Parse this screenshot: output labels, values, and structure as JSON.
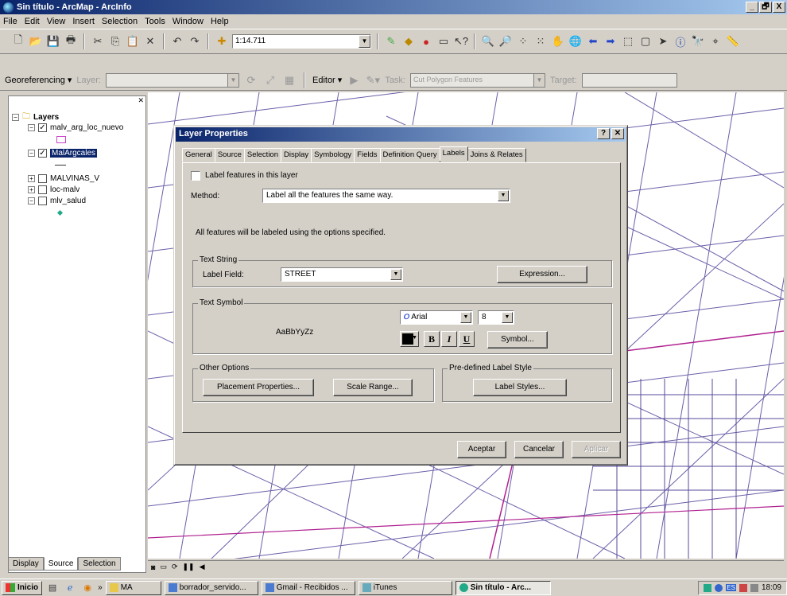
{
  "window": {
    "title": "Sin título - ArcMap - ArcInfo",
    "controls": [
      "_",
      "🗗",
      "X"
    ]
  },
  "menu": [
    "File",
    "Edit",
    "View",
    "Insert",
    "Selection",
    "Tools",
    "Window",
    "Help"
  ],
  "toolbar": {
    "scale": "1:14.711"
  },
  "georef": {
    "label": "Georeferencing ▾",
    "layer_label": "Layer:",
    "editor": "Editor ▾",
    "task_label": "Task:",
    "task_value": "Cut Polygon Features",
    "target_label": "Target:"
  },
  "toc": {
    "root": "Layers",
    "layers": [
      {
        "name": "malv_arg_loc_nuevo",
        "checked": true
      },
      {
        "name": "MalArgcales",
        "checked": true,
        "selected": true
      },
      {
        "name": "MALVINAS_V",
        "checked": false
      },
      {
        "name": "loc-malv",
        "checked": false
      },
      {
        "name": "mlv_salud",
        "checked": false
      }
    ],
    "tabs": [
      "Display",
      "Source",
      "Selection"
    ]
  },
  "dialog": {
    "title": "Layer Properties",
    "tabs": [
      "General",
      "Source",
      "Selection",
      "Display",
      "Symbology",
      "Fields",
      "Definition Query",
      "Labels",
      "Joins & Relates"
    ],
    "active_tab": "Labels",
    "label_features": "Label features in this layer",
    "method_label": "Method:",
    "method_value": "Label all the features the same way.",
    "info": "All features will be labeled using the options specified.",
    "text_string": {
      "group": "Text String",
      "field_label": "Label Field:",
      "field_value": "STREET",
      "expression_btn": "Expression..."
    },
    "text_symbol": {
      "group": "Text Symbol",
      "preview": "AaBbYyZz",
      "font": "Arial",
      "size": "8",
      "bold": "B",
      "italic": "I",
      "underline": "U",
      "symbol_btn": "Symbol..."
    },
    "other": {
      "group": "Other Options",
      "placement_btn": "Placement Properties...",
      "scale_btn": "Scale Range..."
    },
    "predef": {
      "group": "Pre-defined Label Style",
      "styles_btn": "Label Styles..."
    },
    "buttons": {
      "ok": "Aceptar",
      "cancel": "Cancelar",
      "apply": "Aplicar"
    }
  },
  "taskbar": {
    "start": "Inicio",
    "tasks": [
      "MA",
      "borrador_servido...",
      "Gmail - Recibidos ...",
      "iTunes",
      "Sin título - Arc..."
    ],
    "lang": "ES",
    "clock": "18:09"
  }
}
